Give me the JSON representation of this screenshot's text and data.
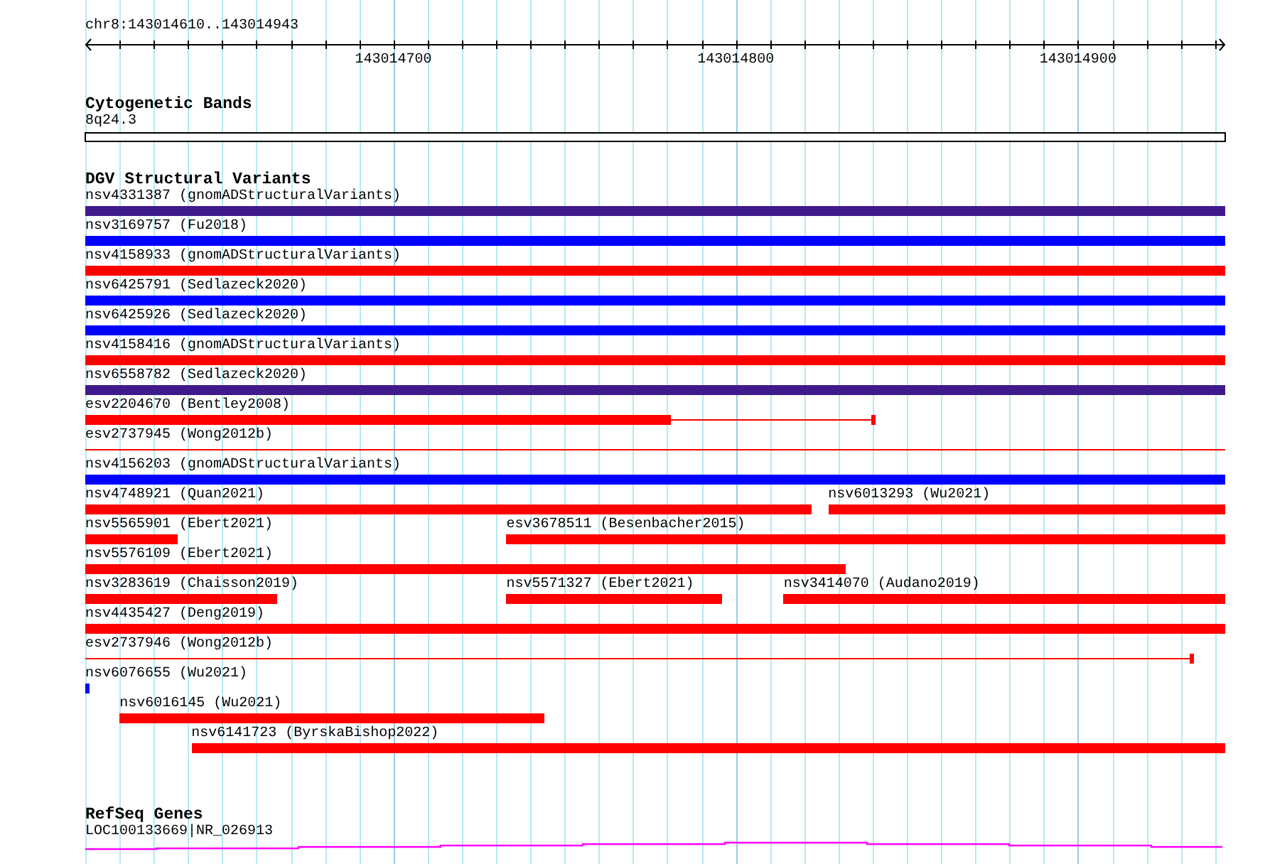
{
  "ruler": {
    "location": "chr8:143014610..143014943",
    "tick_labels": [
      {
        "label": "143014700"
      },
      {
        "label": "143014800"
      },
      {
        "label": "143014900"
      }
    ]
  },
  "cytogenetic_bands": {
    "title": "Cytogenetic Bands",
    "band_label": "8q24.3"
  },
  "dgv_structural_variants": {
    "title": "DGV Structural Variants",
    "rows": [
      {
        "features": [
          {
            "label": "nsv4331387 (gnomADStructuralVariants)",
            "color": "#3f1a8c",
            "kind": "bar"
          }
        ]
      },
      {
        "features": [
          {
            "label": "nsv3169757 (Fu2018)",
            "color": "#0000ff",
            "kind": "bar"
          }
        ]
      },
      {
        "features": [
          {
            "label": "nsv4158933 (gnomADStructuralVariants)",
            "color": "#ff0000",
            "kind": "bar"
          }
        ]
      },
      {
        "features": [
          {
            "label": "nsv6425791 (Sedlazeck2020)",
            "color": "#0000ff",
            "kind": "bar"
          }
        ]
      },
      {
        "features": [
          {
            "label": "nsv6425926 (Sedlazeck2020)",
            "color": "#0000ff",
            "kind": "bar"
          }
        ]
      },
      {
        "features": [
          {
            "label": "nsv4158416 (gnomADStructuralVariants)",
            "color": "#ff0000",
            "kind": "bar"
          }
        ]
      },
      {
        "features": [
          {
            "label": "nsv6558782 (Sedlazeck2020)",
            "color": "#3f1a8c",
            "kind": "bar"
          }
        ]
      },
      {
        "features": [
          {
            "label": "esv2204670 (Bentley2008)",
            "color": "#ff0000",
            "kind": "bar-line"
          }
        ]
      },
      {
        "features": [
          {
            "label": "esv2737945 (Wong2012b)",
            "color": "#ff0000",
            "kind": "line"
          }
        ]
      },
      {
        "features": [
          {
            "label": "nsv4156203 (gnomADStructuralVariants)",
            "color": "#0000ff",
            "kind": "bar"
          }
        ]
      },
      {
        "features": [
          {
            "label": "nsv4748921 (Quan2021)",
            "color": "#ff0000",
            "kind": "bar"
          },
          {
            "label": "nsv6013293 (Wu2021)",
            "color": "#ff0000",
            "kind": "bar"
          }
        ]
      },
      {
        "features": [
          {
            "label": "nsv5565901 (Ebert2021)",
            "color": "#ff0000",
            "kind": "bar"
          },
          {
            "label": "esv3678511 (Besenbacher2015)",
            "color": "#ff0000",
            "kind": "bar"
          }
        ]
      },
      {
        "features": [
          {
            "label": "nsv5576109 (Ebert2021)",
            "color": "#ff0000",
            "kind": "bar"
          }
        ]
      },
      {
        "features": [
          {
            "label": "nsv3283619 (Chaisson2019)",
            "color": "#ff0000",
            "kind": "bar"
          },
          {
            "label": "nsv5571327 (Ebert2021)",
            "color": "#ff0000",
            "kind": "bar"
          },
          {
            "label": "nsv3414070 (Audano2019)",
            "color": "#ff0000",
            "kind": "bar"
          }
        ]
      },
      {
        "features": [
          {
            "label": "nsv4435427 (Deng2019)",
            "color": "#ff0000",
            "kind": "bar"
          }
        ]
      },
      {
        "features": [
          {
            "label": "esv2737946 (Wong2012b)",
            "color": "#ff0000",
            "kind": "line"
          }
        ]
      },
      {
        "features": [
          {
            "label": "nsv6076655 (Wu2021)",
            "color": "#0000ff",
            "kind": "bar"
          }
        ]
      },
      {
        "features": [
          {
            "label": "nsv6016145 (Wu2021)",
            "color": "#ff0000",
            "kind": "bar"
          }
        ]
      },
      {
        "features": [
          {
            "label": "nsv6141723 (ByrskaBishop2022)",
            "color": "#ff0000",
            "kind": "bar"
          }
        ]
      }
    ]
  },
  "refseq_genes": {
    "title": "RefSeq Genes",
    "gene_label": "LOC100133669|NR_026913"
  }
}
